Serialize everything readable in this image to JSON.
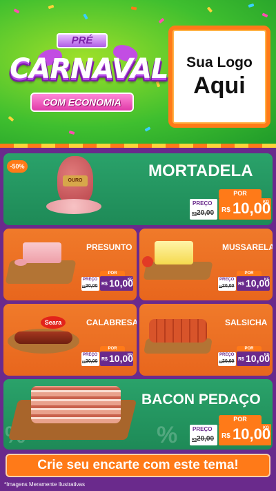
{
  "header": {
    "badge_pre": "PRÉ",
    "badge_title": "CARNAVAL",
    "badge_subtitle": "COM ECONOMIA",
    "logo_line1": "Sua Logo",
    "logo_line2": "Aqui"
  },
  "products": [
    {
      "name": "MORTADELA",
      "discount": "-50%",
      "por": "POR",
      "preco": "PREÇO",
      "old_prefix": "R$",
      "old": "20,00",
      "rs": "R$",
      "price": "10,00",
      "unit": "KG",
      "brand": "OURO"
    },
    {
      "name": "PRESUNTO",
      "por": "POR",
      "preco": "PREÇO",
      "old_prefix": "R$",
      "old": "20,00",
      "rs": "R$",
      "price": "10,00",
      "unit": "KG"
    },
    {
      "name": "MUSSARELA",
      "por": "POR",
      "preco": "PREÇO",
      "old_prefix": "R$",
      "old": "20,00",
      "rs": "R$",
      "price": "10,00",
      "unit": "KG"
    },
    {
      "name": "CALABRESA",
      "por": "POR",
      "preco": "PREÇO",
      "old_prefix": "R$",
      "old": "20,00",
      "rs": "R$",
      "price": "10,00",
      "unit": "KG",
      "brand": "Seara"
    },
    {
      "name": "SALSICHA",
      "por": "POR",
      "preco": "PREÇO",
      "old_prefix": "R$",
      "old": "20,00",
      "rs": "R$",
      "price": "10,00",
      "unit": "KG"
    },
    {
      "name": "BACON PEDAÇO",
      "por": "POR",
      "preco": "PREÇO",
      "old_prefix": "R$",
      "old": "20,00",
      "rs": "R$",
      "price": "10,00",
      "unit": "KG"
    }
  ],
  "cta": "Crie seu encarte com este tema!",
  "footnote": "*Imagens Meramente Ilustrativas",
  "colors": {
    "green": "#2aa26a",
    "orange": "#f07a2a",
    "purple": "#6a2a8c",
    "accent": "#ff7a18"
  }
}
